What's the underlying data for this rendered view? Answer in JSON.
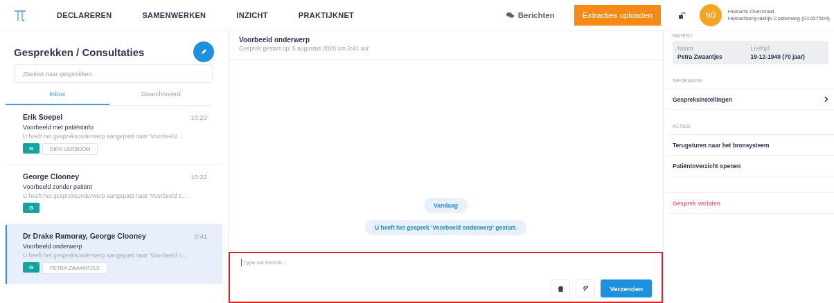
{
  "nav": {
    "items": [
      {
        "label": "DECLAREREN"
      },
      {
        "label": "SAMENWERKEN"
      },
      {
        "label": "INZICHT"
      },
      {
        "label": "PRAKTIJKNET"
      }
    ],
    "messages_link": "Berichten",
    "upload_button": "Extracties uploaden",
    "user": {
      "initials": "NO",
      "name": "Huisarts Overmaat",
      "practice": "Huisartsenpraktijk Costerweg (01057504)"
    }
  },
  "sidebar": {
    "title": "Gesprekken / Consultaties",
    "search": {
      "placeholder": "Zoeken naar gesprekken"
    },
    "tabs": [
      {
        "label": "Inbox",
        "selected": true
      },
      {
        "label": "Gearchiveerd",
        "selected": false
      }
    ],
    "conversations": [
      {
        "name": "Erik Soepel",
        "time": "10:23",
        "subject": "Voorbeeld met patiëntinfo",
        "preview": "U heeft het gespreksonderwerp aangepast naar 'Voorbeeld ...",
        "badge": "G",
        "patient": "DIRK VERBOOM",
        "selected": false
      },
      {
        "name": "George Clooney",
        "time": "10:22",
        "subject": "Voorbeeld zonder patiënt",
        "preview": "U heeft het gespreksonderwerp aangepast naar 'Voorbeeld z...",
        "badge": "G",
        "selected": false
      },
      {
        "name": "Dr Drake Ramoray, George Clooney",
        "time": "9:41",
        "subject": "Voorbeeld onderwerp",
        "preview": "U heeft het gespreksonderwerp aangepast naar 'Voorbeeld o...",
        "badge": "G",
        "patient": "PETRA ZWAANTJES",
        "selected": true
      }
    ]
  },
  "chat": {
    "title": "Voorbeeld onderwerp",
    "subtitle": "Gesprek gestart op: 5 augustus 2020 om 9:41 uur",
    "date_label": "Vandaag",
    "system_message": "U heeft het gesprek 'Voorbeeld onderwerp' gestart.",
    "composer": {
      "placeholder": "Type uw bericht...",
      "highlighted": true,
      "send_button": "Verzenden"
    }
  },
  "details": {
    "patient_header": "PATIËNT",
    "patient": [
      {
        "label": "Naam",
        "value": "Petra Zwaantjes"
      },
      {
        "label": "Leeftijd",
        "value": "19-12-1949 (70 jaar)"
      }
    ],
    "sections": [
      {
        "header": "INFORMATIE",
        "items": [
          {
            "label": "Gespreksinstellingen",
            "kind": "link"
          }
        ]
      },
      {
        "header": "ACTIES",
        "items": [
          {
            "label": "Terugsturen naar het bronsysteem",
            "kind": "action"
          },
          {
            "label": "Patiëntoverzicht openen",
            "kind": "action"
          }
        ]
      },
      {
        "items": [
          {
            "label": "Gesprek verlaten",
            "kind": "danger"
          }
        ]
      }
    ]
  }
}
